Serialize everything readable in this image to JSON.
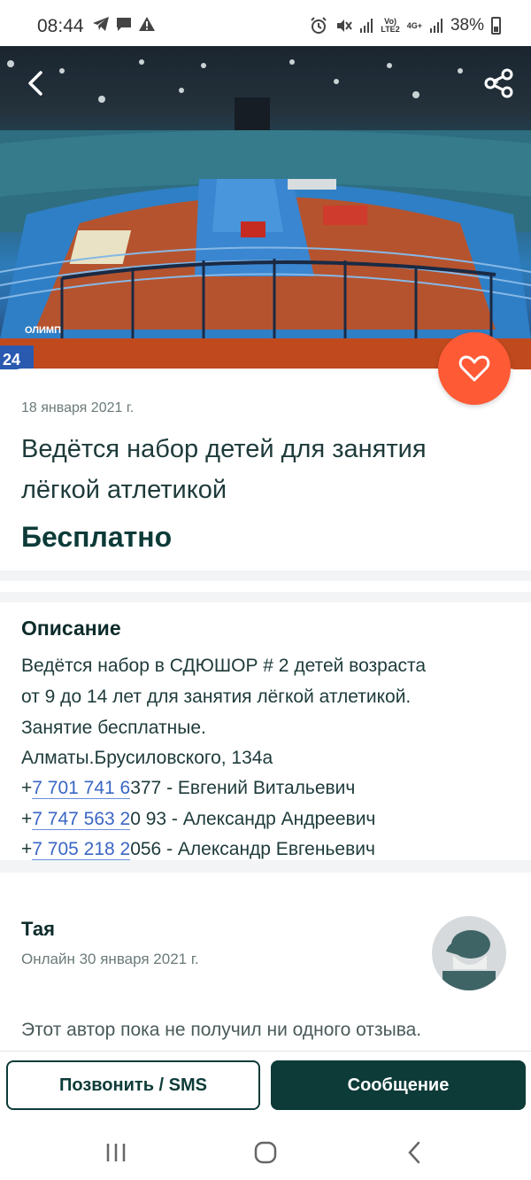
{
  "status_bar": {
    "time": "08:44",
    "battery": "38%",
    "network_top": "Vo)",
    "network_bottom": "LTE2",
    "gen": "4G+"
  },
  "hero": {
    "image_caption": "ОЛИМП",
    "corner_number": "24"
  },
  "listing": {
    "date": "18 января 2021 г.",
    "title": "Ведётся набор детей для занятия лёгкой атлетикой",
    "price": "Бесплатно"
  },
  "description": {
    "heading": "Описание",
    "line1": "Ведётся набор в СДЮШОР # 2 детей возраста",
    "line2": "от 9 до 14 лет для занятия лёгкой атлетикой.",
    "line3": "Занятие бесплатные.",
    "line4": "Алматы.Брусиловского, 134а",
    "phones": [
      {
        "prefix": "+",
        "link": "7 701 741 6",
        "rest": "377 - Евгений Витальевич"
      },
      {
        "prefix": "+",
        "link": "7 747 563 2",
        "rest": "0 93 - Александр Андреевич"
      },
      {
        "prefix": "+",
        "link": "7 705 218 2",
        "rest": "056 - Александр Евгеньевич"
      }
    ]
  },
  "author": {
    "name": "Тая",
    "online": "Онлайн 30 января 2021 г.",
    "reviews": "Этот автор пока не получил ни одного отзыва."
  },
  "actions": {
    "call": "Позвонить / SMS",
    "message": "Сообщение"
  },
  "colors": {
    "accent": "#ff5a36",
    "primary_dark": "#0c3b38",
    "link": "#3a66c4"
  }
}
